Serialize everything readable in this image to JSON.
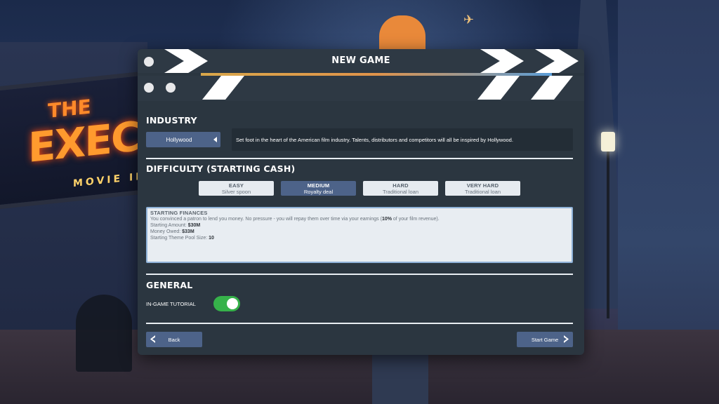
{
  "background": {
    "sign_line1": "THE",
    "sign_line2": "EXEC",
    "sign_line3": "MOVIE IN"
  },
  "dialog": {
    "title": "NEW GAME"
  },
  "industry": {
    "section_title": "INDUSTRY",
    "selected": "Hollywood",
    "description": "Set foot in the heart of the American film industry. Talents, distributors and competitors will all be inspired by Hollywood."
  },
  "difficulty": {
    "section_title": "DIFFICULTY (STARTING CASH)",
    "options": [
      {
        "label": "EASY",
        "sub": "Silver spoon"
      },
      {
        "label": "MEDIUM",
        "sub": "Royalty deal"
      },
      {
        "label": "HARD",
        "sub": "Traditional loan"
      },
      {
        "label": "VERY HARD",
        "sub": "Traditional loan"
      }
    ],
    "selected": "MEDIUM"
  },
  "finances": {
    "heading": "STARTING FINANCES",
    "text_before": "You convinced a patron to lend you money. No pressure - you will repay them over time via your earnings (",
    "percent": "10%",
    "text_after": " of your film revenue).",
    "amount_label": "Starting Amount:",
    "amount_value": "$30M",
    "owed_label": "Money Owed:",
    "owed_value": "$33M",
    "pool_label": "Starting Theme Pool Size:",
    "pool_value": "10"
  },
  "general": {
    "section_title": "GENERAL",
    "tutorial_label": "IN-GAME TUTORIAL",
    "tutorial_enabled": true
  },
  "nav": {
    "back_label": "Back",
    "start_label": "Start Game"
  },
  "colors": {
    "panel": "#2b3640",
    "button": "#4d6389",
    "toggle_on": "#36b24a",
    "finance_border": "#8fb2d8"
  }
}
